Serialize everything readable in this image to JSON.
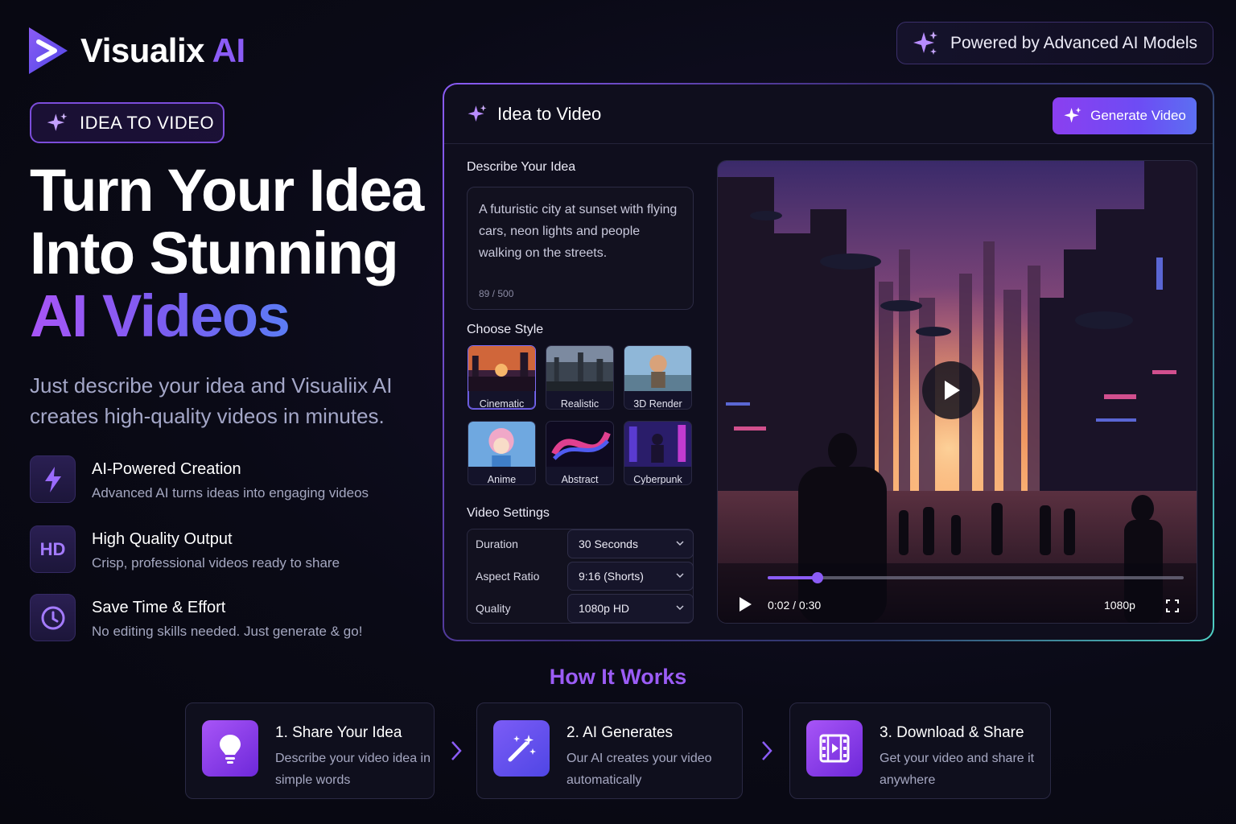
{
  "brand": {
    "name": "Visualix",
    "name_accent": "AI"
  },
  "powered_badge": "Powered by Advanced AI Models",
  "hero": {
    "tag": "IDEA TO VIDEO",
    "headline_line1": "Turn Your Idea",
    "headline_line2": "Into Stunning",
    "headline_line3": "AI Videos",
    "subtitle": "Just describe your idea and Visualiix AI creates high-quality videos in minutes."
  },
  "features": [
    {
      "icon": "lightning-icon",
      "title": "AI-Powered Creation",
      "desc": "Advanced AI turns ideas into engaging videos"
    },
    {
      "icon": "hd-icon",
      "badge": "HD",
      "title": "High Quality Output",
      "desc": "Crisp, professional videos ready to share"
    },
    {
      "icon": "clock-icon",
      "title": "Save Time & Effort",
      "desc": "No editing skills needed. Just generate & go!"
    }
  ],
  "panel": {
    "title": "Idea to Video",
    "generate_label": "Generate Video",
    "describe_label": "Describe Your Idea",
    "idea_text": "A futuristic city at sunset with flying cars, neon lights and people walking on the streets.",
    "char_count": "89 / 500",
    "style_label": "Choose Style",
    "styles": [
      {
        "name": "Cinematic",
        "selected": true
      },
      {
        "name": "Realistic",
        "selected": false
      },
      {
        "name": "3D Render",
        "selected": false
      },
      {
        "name": "Anime",
        "selected": false
      },
      {
        "name": "Abstract",
        "selected": false
      },
      {
        "name": "Cyberpunk",
        "selected": false
      }
    ],
    "settings_label": "Video Settings",
    "settings": [
      {
        "name": "Duration",
        "value": "30 Seconds"
      },
      {
        "name": "Aspect Ratio",
        "value": "9:16 (Shorts)"
      },
      {
        "name": "Quality",
        "value": "1080p HD"
      }
    ]
  },
  "video": {
    "time": "0:02 / 0:30",
    "resolution": "1080p",
    "progress": 0.12
  },
  "how": {
    "title": "How It Works",
    "steps": [
      {
        "icon": "lightbulb-icon",
        "title": "1. Share Your Idea",
        "desc": "Describe your video idea in simple words"
      },
      {
        "icon": "magic-wand-icon",
        "title": "2. AI Generates",
        "desc": "Our AI creates your video automatically"
      },
      {
        "icon": "film-icon",
        "title": "3. Download & Share",
        "desc": "Get your video and share it anywhere"
      }
    ]
  },
  "colors": {
    "accent": "#8b5cf6",
    "accent_blue": "#5b7cf5",
    "background": "#0a0a16"
  }
}
